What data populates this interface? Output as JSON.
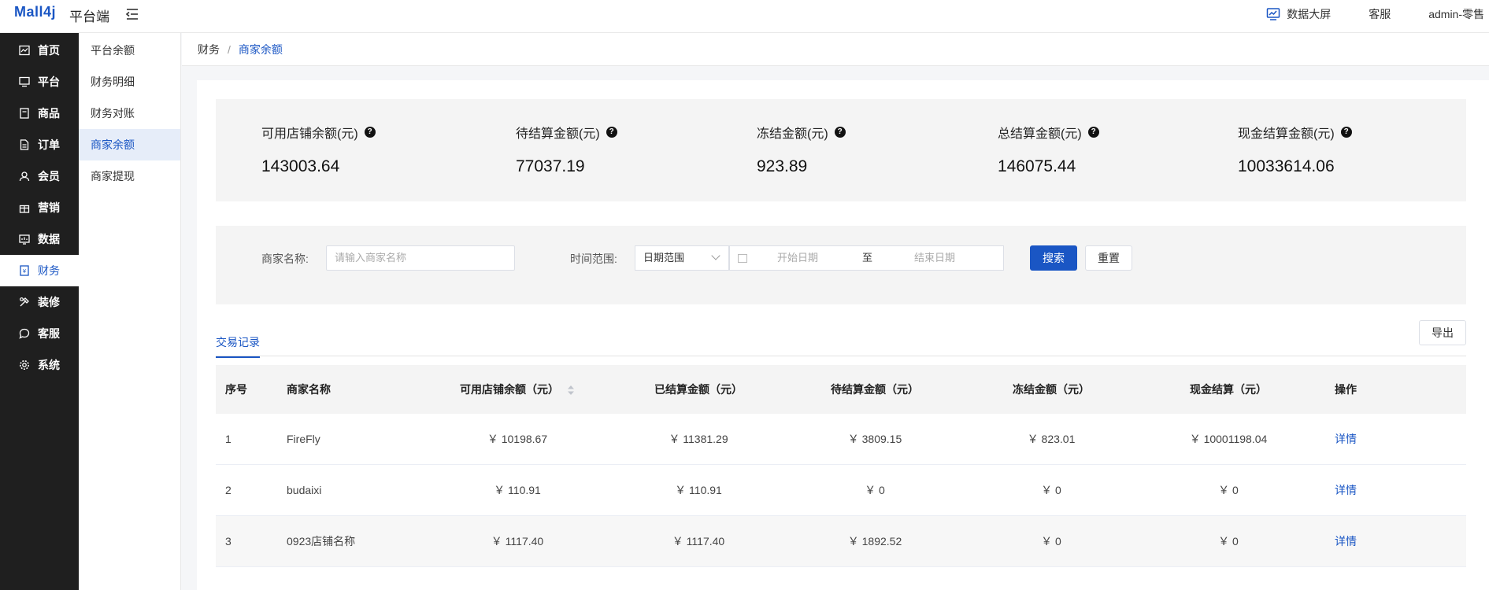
{
  "header": {
    "logo": "Mall4j",
    "subtitle": "平台端",
    "data_screen": "数据大屏",
    "customer_service": "客服",
    "user": "admin-零售"
  },
  "sidebar": {
    "items": [
      {
        "label": "首页",
        "icon": "dashboard-icon"
      },
      {
        "label": "平台",
        "icon": "monitor-icon"
      },
      {
        "label": "商品",
        "icon": "box-icon"
      },
      {
        "label": "订单",
        "icon": "order-icon"
      },
      {
        "label": "会员",
        "icon": "member-icon"
      },
      {
        "label": "营销",
        "icon": "gift-icon"
      },
      {
        "label": "数据",
        "icon": "chart-icon"
      },
      {
        "label": "财务",
        "icon": "finance-icon"
      },
      {
        "label": "装修",
        "icon": "decor-icon"
      },
      {
        "label": "客服",
        "icon": "chat-icon"
      },
      {
        "label": "系统",
        "icon": "gear-icon"
      }
    ],
    "active_index": 7
  },
  "subnav": {
    "items": [
      "平台余额",
      "财务明细",
      "财务对账",
      "商家余额",
      "商家提现"
    ],
    "active_index": 3
  },
  "breadcrumb": {
    "parent": "财务",
    "separator": "/",
    "current": "商家余额"
  },
  "stats": [
    {
      "label": "可用店铺余额(元)",
      "value": "143003.64"
    },
    {
      "label": "待结算金额(元)",
      "value": "77037.19"
    },
    {
      "label": "冻结金额(元)",
      "value": "923.89"
    },
    {
      "label": "总结算金额(元)",
      "value": "146075.44"
    },
    {
      "label": "现金结算金额(元)",
      "value": "10033614.06"
    }
  ],
  "filter": {
    "merchant_label": "商家名称:",
    "merchant_placeholder": "请输入商家名称",
    "time_label": "时间范围:",
    "range_select": "日期范围",
    "start_placeholder": "开始日期",
    "to": "至",
    "end_placeholder": "结束日期",
    "search": "搜索",
    "reset": "重置"
  },
  "tabs": {
    "active": "交易记录",
    "export": "导出"
  },
  "table": {
    "headers": [
      "序号",
      "商家名称",
      "可用店铺余额（元）",
      "已结算金额（元）",
      "待结算金额（元）",
      "冻结金额（元）",
      "现金结算（元）",
      "操作"
    ],
    "action_label": "详情",
    "rows": [
      [
        "1",
        "FireFly",
        "￥ 10198.67",
        "￥ 11381.29",
        "￥ 3809.15",
        "￥ 823.01",
        "￥ 10001198.04"
      ],
      [
        "2",
        "budaixi",
        "￥ 110.91",
        "￥ 110.91",
        "￥ 0",
        "￥ 0",
        "￥ 0"
      ],
      [
        "3",
        "0923店铺名称",
        "￥ 1117.40",
        "￥ 1117.40",
        "￥ 1892.52",
        "￥ 0",
        "￥ 0"
      ]
    ]
  }
}
